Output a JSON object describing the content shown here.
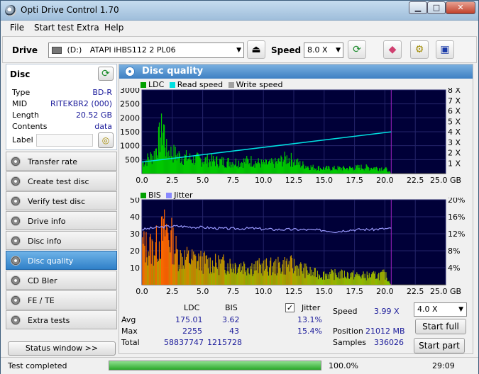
{
  "window": {
    "title": "Opti Drive Control 1.70",
    "btn_min": "▁",
    "btn_max": "□",
    "btn_close": "✕"
  },
  "menu": [
    "File",
    "Start test",
    "Extra",
    "Help"
  ],
  "toolbar": {
    "drive_label": "Drive",
    "drive_letter": "(D:)",
    "drive_name": "ATAPI iHBS112   2 PL06",
    "speed_label": "Speed",
    "speed_value": "8.0 X"
  },
  "disc": {
    "header": "Disc",
    "rows": [
      {
        "label": "Type",
        "value": "BD-R"
      },
      {
        "label": "MID",
        "value": "RITEKBR2 (000)"
      },
      {
        "label": "Length",
        "value": "20.52 GB"
      },
      {
        "label": "Contents",
        "value": "data"
      }
    ],
    "label_label": "Label",
    "label_value": ""
  },
  "nav": [
    {
      "label": "Transfer rate",
      "active": false
    },
    {
      "label": "Create test disc",
      "active": false
    },
    {
      "label": "Verify test disc",
      "active": false
    },
    {
      "label": "Drive info",
      "active": false
    },
    {
      "label": "Disc info",
      "active": false
    },
    {
      "label": "Disc quality",
      "active": true
    },
    {
      "label": "CD Bler",
      "active": false
    },
    {
      "label": "FE / TE",
      "active": false
    },
    {
      "label": "Extra tests",
      "active": false
    }
  ],
  "status_window_btn": "Status window >>",
  "main_title": "Disc quality",
  "chart_data": [
    {
      "type": "area",
      "legend": [
        "LDC",
        "Read speed",
        "Write speed"
      ],
      "colors": {
        "LDC": "#00c800",
        "Read speed": "#00e0e0",
        "Write speed": "#a0a0a0"
      },
      "x_ticks": [
        "0.0",
        "2.5",
        "5.0",
        "7.5",
        "10.0",
        "12.5",
        "15.0",
        "17.5",
        "20.0",
        "22.5",
        "25.0 GB"
      ],
      "y_ticks": [
        "3000",
        "2500",
        "2000",
        "1500",
        "1000",
        "500"
      ],
      "y2_ticks": [
        "8 X",
        "7 X",
        "6 X",
        "5 X",
        "4 X",
        "3 X",
        "2 X",
        "1 X"
      ],
      "xlim": [
        0,
        25
      ],
      "ylim": [
        0,
        3000
      ],
      "y2lim": [
        0,
        8
      ],
      "disc_end_gb": 20.52,
      "read_speed": {
        "x": [
          0,
          20.52
        ],
        "y": [
          1.1,
          3.99
        ]
      },
      "ldc_profile": {
        "x": [
          0,
          1,
          1.8,
          2,
          3,
          4,
          5,
          6,
          7,
          8,
          9,
          10,
          11,
          12,
          13,
          14,
          15,
          16,
          17,
          18,
          19,
          20,
          20.52
        ],
        "y": [
          500,
          900,
          2255,
          1100,
          850,
          700,
          650,
          600,
          550,
          550,
          600,
          450,
          500,
          750,
          450,
          300,
          250,
          250,
          250,
          300,
          280,
          250,
          0
        ]
      }
    },
    {
      "type": "area",
      "legend": [
        "BIS",
        "Jitter"
      ],
      "colors": {
        "BIS": "#00c800",
        "Jitter": "#8888ff"
      },
      "x_ticks": [
        "0.0",
        "2.5",
        "5.0",
        "7.5",
        "10.0",
        "12.5",
        "15.0",
        "17.5",
        "20.0",
        "22.5",
        "25.0 GB"
      ],
      "y_ticks": [
        "50",
        "40",
        "30",
        "20",
        "10"
      ],
      "y2_ticks": [
        "20%",
        "16%",
        "12%",
        "8%",
        "4%"
      ],
      "xlim": [
        0,
        25
      ],
      "ylim": [
        0,
        50
      ],
      "y2lim": [
        0,
        20
      ],
      "disc_end_gb": 20.52,
      "jitter": {
        "x": [
          0,
          1,
          2,
          3,
          4,
          5,
          6,
          7,
          8,
          9,
          10,
          11,
          12,
          13,
          14,
          15,
          16,
          17,
          18,
          19,
          20,
          20.52
        ],
        "y": [
          13.0,
          13.4,
          13.7,
          13.8,
          13.6,
          13.5,
          13.3,
          13.2,
          13.2,
          13.3,
          13.1,
          13.0,
          13.0,
          13.0,
          12.9,
          12.8,
          12.5,
          12.9,
          13.0,
          13.0,
          13.2,
          13.2
        ]
      },
      "bis_profile": {
        "x": [
          0,
          1,
          2,
          2.5,
          3,
          4,
          5,
          6,
          7,
          8,
          9,
          10,
          11,
          12,
          13,
          14,
          15,
          16,
          17,
          18,
          19,
          20,
          20.52
        ],
        "y": [
          30,
          28,
          43,
          34,
          22,
          20,
          18,
          16,
          16,
          15,
          14,
          14,
          14,
          16,
          13,
          9,
          8,
          8,
          8,
          7,
          7,
          8,
          0
        ]
      }
    }
  ],
  "stats": {
    "col_ldc": "LDC",
    "col_bis": "BIS",
    "col_jitter": "Jitter",
    "jitter_checked": "✓",
    "rows": [
      {
        "label": "Avg",
        "ldc": "175.01",
        "bis": "3.62",
        "jitter": "13.1%"
      },
      {
        "label": "Max",
        "ldc": "2255",
        "bis": "43",
        "jitter": "15.4%"
      },
      {
        "label": "Total",
        "ldc": "58837747",
        "bis": "1215728",
        "jitter": ""
      }
    ],
    "speed_label": "Speed",
    "speed_value": "3.99 X",
    "position_label": "Position",
    "position_value": "21012 MB",
    "samples_label": "Samples",
    "samples_value": "336026",
    "speed_select": "4.0 X",
    "start_full": "Start full",
    "start_part": "Start part"
  },
  "statusbar": {
    "text": "Test completed",
    "progress": 100.0,
    "progress_text": "100.0%",
    "time": "29:09"
  }
}
